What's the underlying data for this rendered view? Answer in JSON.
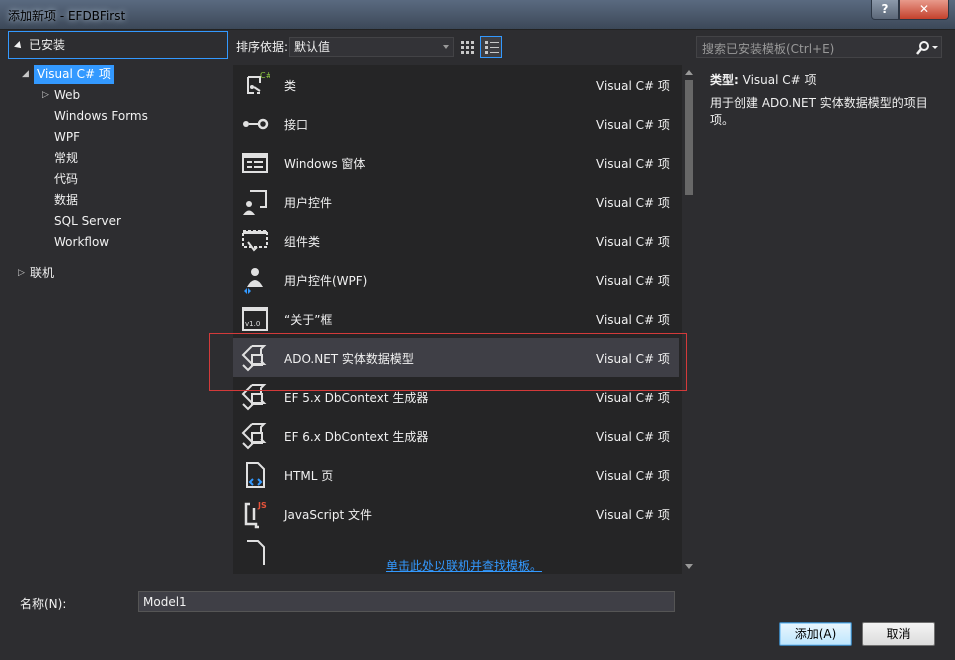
{
  "window": {
    "title": "添加新项 - EFDBFirst",
    "help_label": "?",
    "close_label": "✕"
  },
  "tree": {
    "header": "已安装",
    "items": [
      {
        "label": "Visual C# 项",
        "expander": "◢"
      },
      {
        "label": "Web",
        "expander": "▷"
      },
      {
        "label": "Windows Forms"
      },
      {
        "label": "WPF"
      },
      {
        "label": "常规"
      },
      {
        "label": "代码"
      },
      {
        "label": "数据"
      },
      {
        "label": "SQL Server"
      },
      {
        "label": "Workflow"
      },
      {
        "label": "联机",
        "expander": "▷"
      }
    ]
  },
  "toolbar": {
    "sort_label": "排序依据:",
    "sort_value": "默认值"
  },
  "items": [
    {
      "name": "类",
      "category": "Visual C# 项",
      "icon": "class-icon"
    },
    {
      "name": "接口",
      "category": "Visual C# 项",
      "icon": "interface-icon"
    },
    {
      "name": "Windows 窗体",
      "category": "Visual C# 项",
      "icon": "windows-form-icon"
    },
    {
      "name": "用户控件",
      "category": "Visual C# 项",
      "icon": "user-control-icon"
    },
    {
      "name": "组件类",
      "category": "Visual C# 项",
      "icon": "component-class-icon"
    },
    {
      "name": "用户控件(WPF)",
      "category": "Visual C# 项",
      "icon": "wpf-user-control-icon"
    },
    {
      "name": "“关于”框",
      "category": "Visual C# 项",
      "icon": "about-box-icon"
    },
    {
      "name": "ADO.NET 实体数据模型",
      "category": "Visual C# 项",
      "icon": "entity-data-model-icon"
    },
    {
      "name": "EF 5.x DbContext 生成器",
      "category": "Visual C# 项",
      "icon": "dbcontext-generator-icon"
    },
    {
      "name": "EF 6.x DbContext 生成器",
      "category": "Visual C# 项",
      "icon": "dbcontext-generator-icon"
    },
    {
      "name": "HTML 页",
      "category": "Visual C# 项",
      "icon": "html-page-icon"
    },
    {
      "name": "JavaScript 文件",
      "category": "Visual C# 项",
      "icon": "javascript-file-icon"
    }
  ],
  "search": {
    "placeholder": "搜索已安装模板(Ctrl+E)"
  },
  "details": {
    "type_label": "类型:",
    "type_value": "Visual C# 项",
    "description": "用于创建 ADO.NET 实体数据模型的项目项。"
  },
  "online_link": "单击此处以联机并查找模板。",
  "name_field": {
    "label": "名称(N):",
    "value": "Model1"
  },
  "buttons": {
    "add": "添加(A)",
    "cancel": "取消"
  }
}
